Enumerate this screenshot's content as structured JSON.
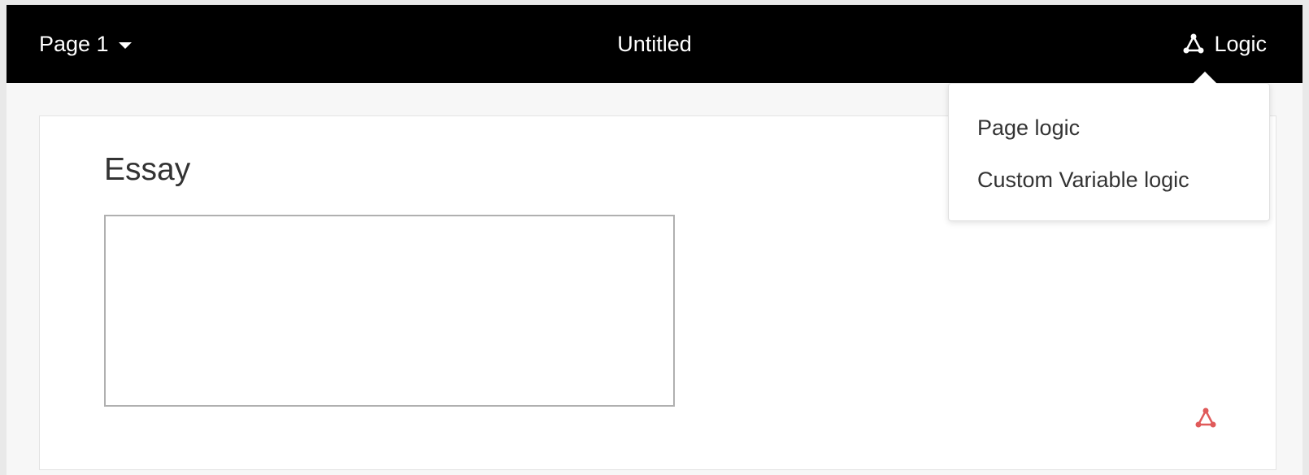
{
  "header": {
    "page_selector_label": "Page 1",
    "title": "Untitled",
    "logic_label": "Logic"
  },
  "logic_menu": {
    "items": [
      {
        "label": "Page logic"
      },
      {
        "label": "Custom Variable logic"
      }
    ]
  },
  "question": {
    "label": "Essay",
    "value": ""
  },
  "colors": {
    "topbar_bg": "#000000",
    "accent_logic_icon": "#e05a5a"
  }
}
